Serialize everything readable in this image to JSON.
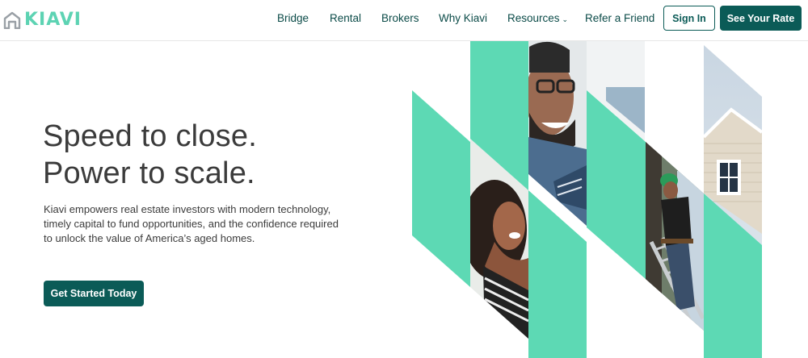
{
  "brand": {
    "name": "KIAVI",
    "color": "#5dd3b3",
    "icon": "house-logo-icon"
  },
  "nav": {
    "items": [
      {
        "label": "Bridge"
      },
      {
        "label": "Rental"
      },
      {
        "label": "Brokers"
      },
      {
        "label": "Why Kiavi"
      },
      {
        "label": "Resources",
        "icon": "chevron-down-icon"
      },
      {
        "label": "Refer a Friend"
      }
    ],
    "signin_label": "Sign In",
    "rate_label": "See Your Rate"
  },
  "hero": {
    "title_line1": "Speed to close.",
    "title_line2": "Power to scale.",
    "description": "Kiavi empowers real estate investors with modern technology, timely capital to fund opportunities, and the confidence required to unlock the value of America’s aged homes.",
    "cta_label": "Get Started Today"
  },
  "colors": {
    "primary": "#0b5b57",
    "accent": "#5dd3b3",
    "text": "#3b3b3b"
  }
}
